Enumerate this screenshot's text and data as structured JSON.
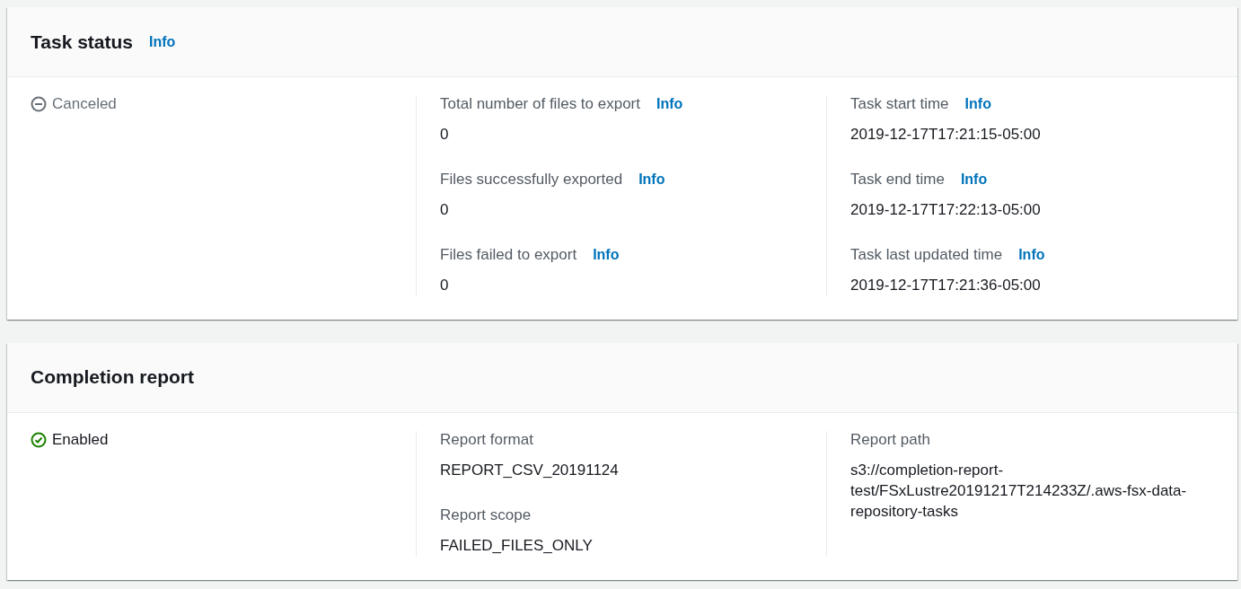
{
  "panels": [
    {
      "title": "Task status",
      "info": "Info",
      "status": {
        "kind": "canceled",
        "text": "Canceled"
      },
      "columns": [
        [
          {
            "label": "Total number of files to export",
            "info": "Info",
            "value": "0"
          },
          {
            "label": "Files successfully exported",
            "info": "Info",
            "value": "0"
          },
          {
            "label": "Files failed to export",
            "info": "Info",
            "value": "0"
          }
        ],
        [
          {
            "label": "Task start time",
            "info": "Info",
            "value": "2019-12-17T17:21:15-05:00"
          },
          {
            "label": "Task end time",
            "info": "Info",
            "value": "2019-12-17T17:22:13-05:00"
          },
          {
            "label": "Task last updated time",
            "info": "Info",
            "value": "2019-12-17T17:21:36-05:00"
          }
        ]
      ]
    },
    {
      "title": "Completion report",
      "status": {
        "kind": "enabled",
        "text": "Enabled"
      },
      "columns": [
        [
          {
            "label": "Report format",
            "value": "REPORT_CSV_20191124"
          },
          {
            "label": "Report scope",
            "value": "FAILED_FILES_ONLY"
          }
        ],
        [
          {
            "label": "Report path",
            "value": "s3://completion-report-test/FSxLustre20191217T214233Z/.aws-fsx-data-repository-tasks"
          }
        ]
      ]
    }
  ]
}
